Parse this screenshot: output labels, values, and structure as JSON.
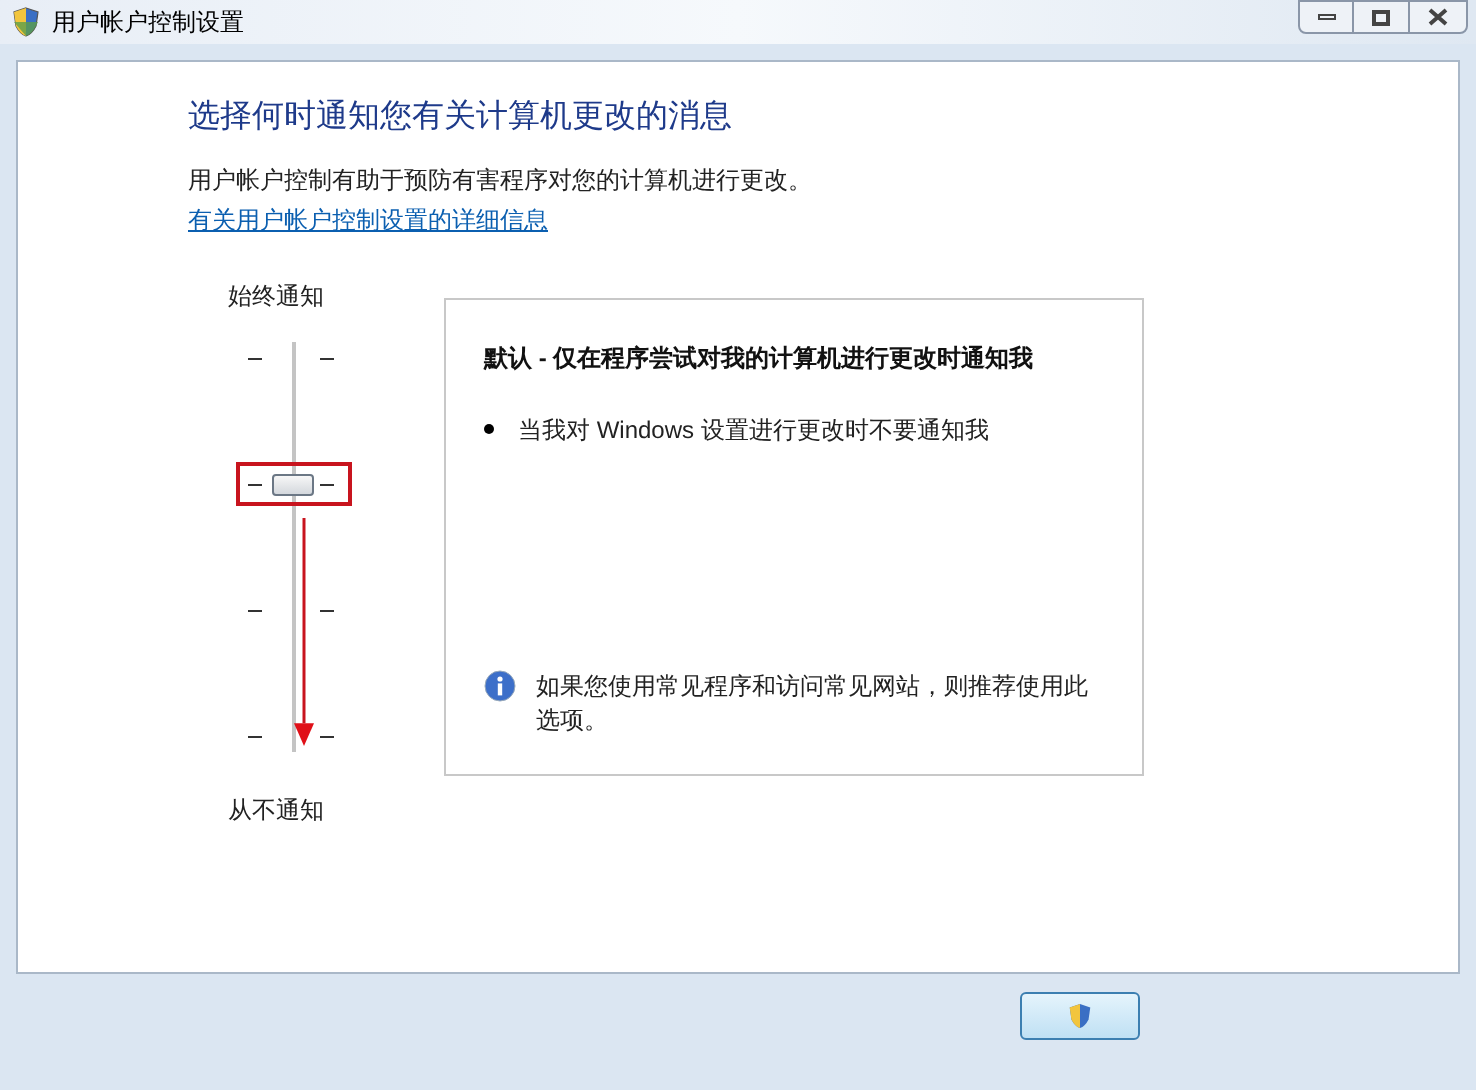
{
  "window": {
    "title": "用户帐户控制设置"
  },
  "heading": "选择何时通知您有关计算机更改的消息",
  "description": "用户帐户控制有助于预防有害程序对您的计算机进行更改。",
  "link": "有关用户帐户控制设置的详细信息",
  "slider": {
    "top_label": "始终通知",
    "bottom_label": "从不通知",
    "level": 0.667
  },
  "panel": {
    "title": "默认 - 仅在程序尝试对我的计算机进行更改时通知我",
    "bullets": [
      "当我对 Windows 设置进行更改时不要通知我"
    ],
    "info": "如果您使用常见程序和访问常见网站，则推荐使用此选项。"
  },
  "ok_button": {
    "focused": true
  }
}
